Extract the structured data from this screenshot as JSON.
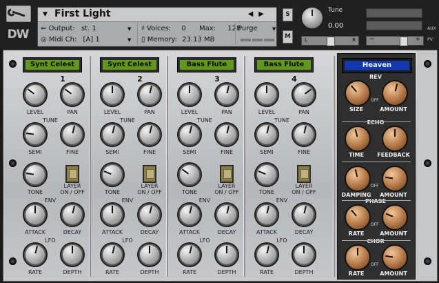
{
  "header": {
    "instrument_name": "First Light",
    "output_label": "Output:",
    "output_value": "st. 1",
    "midi_label": "Midi Ch:",
    "midi_value": "[A]  1",
    "voices_label": "Voices:",
    "voices_value": "0",
    "max_label": "Max:",
    "max_value": "128",
    "purge_label": "Purge",
    "memory_label": "Memory:",
    "memory_value": "23.13 MB",
    "solo_label": "S",
    "mute_label": "M",
    "tune_label": "Tune",
    "tune_value": "0.00",
    "balance_left": "L",
    "balance_right": "R",
    "aux_label": "AUX",
    "pv_label": "PV",
    "logo": "DW"
  },
  "layers": [
    {
      "number": "1",
      "patch": "Synt Celest",
      "knobs": {
        "level": 0.3,
        "pan": 0.3,
        "semi": 0.2,
        "fine": 0.55,
        "tone": 0.2,
        "attack": 0.5,
        "decay": 0.55,
        "rate": 0.55,
        "depth": 0.5
      }
    },
    {
      "number": "2",
      "patch": "Synt Celest",
      "knobs": {
        "level": 0.5,
        "pan": 0.55,
        "semi": 0.55,
        "fine": 0.55,
        "tone": 0.25,
        "attack": 0.5,
        "decay": 0.55,
        "rate": 0.55,
        "depth": 0.5
      }
    },
    {
      "number": "3",
      "patch": "Bass Flute",
      "knobs": {
        "level": 0.5,
        "pan": 0.55,
        "semi": 0.55,
        "fine": 0.55,
        "tone": 0.3,
        "attack": 0.55,
        "decay": 0.55,
        "rate": 0.55,
        "depth": 0.5
      }
    },
    {
      "number": "4",
      "patch": "Bass Flute",
      "knobs": {
        "level": 0.5,
        "pan": 0.7,
        "semi": 0.55,
        "fine": 0.55,
        "tone": 0.25,
        "attack": 0.55,
        "decay": 0.55,
        "rate": 0.55,
        "depth": 0.5
      }
    }
  ],
  "labels": {
    "level": "LEVEL",
    "pan": "PAN",
    "tune": "TUNE",
    "semi": "SEMI",
    "fine": "FINE",
    "tone": "TONE",
    "layer": "LAYER",
    "on_off": "ON / OFF",
    "env": "ENV",
    "attack": "ATTACK",
    "decay": "DECAY",
    "lfo": "LFO",
    "rate": "RATE",
    "depth": "DEPTH"
  },
  "fx": {
    "preset": "Heaven",
    "rev": "REV",
    "size": "SIZE",
    "amount": "AMOUNT",
    "off": "OFF",
    "echo": "ECHO",
    "time": "TIME",
    "feedback": "FEEDBACK",
    "damping": "DAMPING",
    "phase": "PHASE",
    "rate": "RATE",
    "chor": "CHOR",
    "knobs": {
      "size": 0.35,
      "rev_amount": 0.55,
      "time": 0.45,
      "feedback": 0.5,
      "damping": 0.45,
      "echo_amount": 0.2,
      "phase_rate": 0.35,
      "phase_amount": 0.25,
      "chor_rate": 0.5,
      "chor_amount": 0.2
    }
  },
  "colors": {
    "patch_display": "#5f9a1a",
    "fx_display": "#1338ad",
    "fx_knob": "#b27442",
    "panel": "#c2c4c6"
  }
}
